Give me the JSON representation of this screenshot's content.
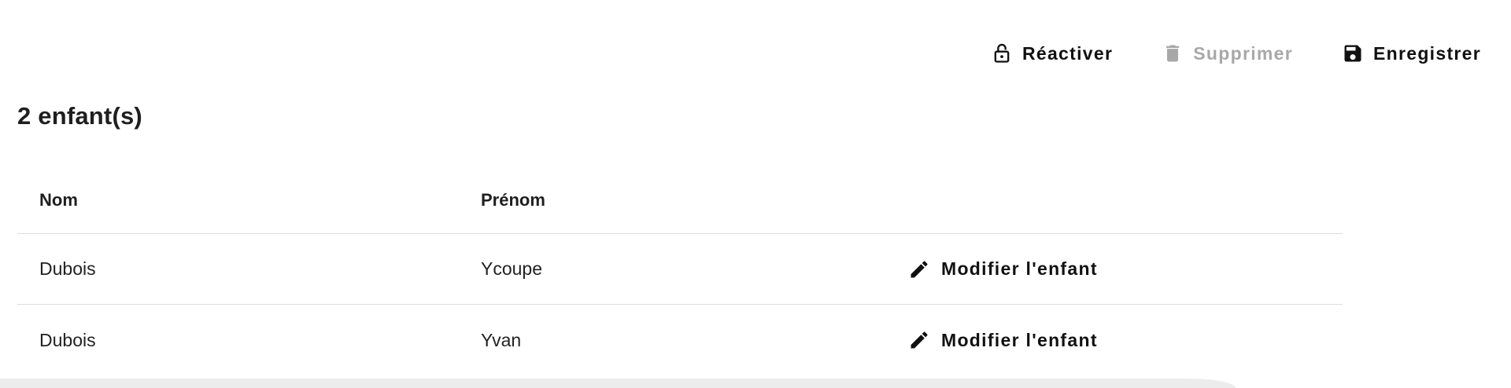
{
  "toolbar": {
    "reactivate": {
      "label": "Réactiver",
      "icon": "lock-open-icon"
    },
    "delete": {
      "label": "Supprimer",
      "icon": "trash-icon",
      "disabled": true
    },
    "save": {
      "label": "Enregistrer",
      "icon": "save-icon"
    }
  },
  "heading": "2 enfant(s)",
  "table": {
    "columns": [
      "Nom",
      "Prénom",
      ""
    ],
    "rows": [
      {
        "nom": "Dubois",
        "prenom": "Ycoupe",
        "action": "Modifier l'enfant"
      },
      {
        "nom": "Dubois",
        "prenom": "Yvan",
        "action": "Modifier l'enfant"
      }
    ]
  },
  "colors": {
    "text": "#1f1f1f",
    "disabled": "#a8a8a8",
    "divider": "#dcdcdc"
  }
}
